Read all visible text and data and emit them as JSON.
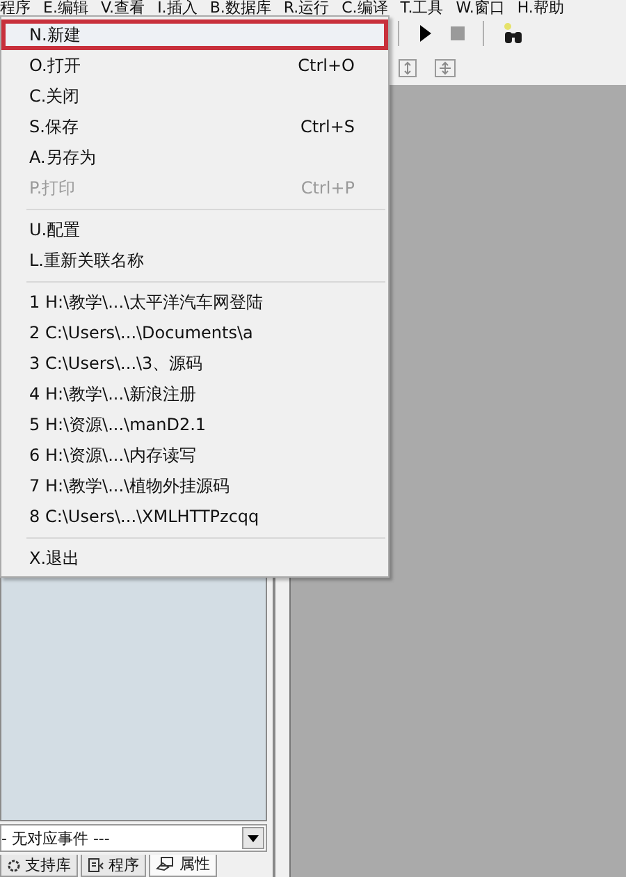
{
  "menubar": {
    "items": [
      {
        "label": "程序"
      },
      {
        "label": "E.编辑"
      },
      {
        "label": "V.查看"
      },
      {
        "label": "I.插入"
      },
      {
        "label": "B.数据库"
      },
      {
        "label": "R.运行"
      },
      {
        "label": "C.编译"
      },
      {
        "label": "T.工具"
      },
      {
        "label": "W.窗口"
      },
      {
        "label": "H.帮助"
      }
    ]
  },
  "file_menu": {
    "groups": [
      [
        {
          "label": "N.新建",
          "highlighted": true,
          "disabled": false
        },
        {
          "label": "O.打开",
          "shortcut": "Ctrl+O",
          "highlighted": false,
          "disabled": false
        },
        {
          "label": "C.关闭",
          "highlighted": false,
          "disabled": false
        },
        {
          "label": "S.保存",
          "shortcut": "Ctrl+S",
          "highlighted": false,
          "disabled": false
        },
        {
          "label": "A.另存为",
          "highlighted": false,
          "disabled": false
        },
        {
          "label": "P.打印",
          "shortcut": "Ctrl+P",
          "highlighted": false,
          "disabled": true
        }
      ],
      [
        {
          "label": "U.配置",
          "highlighted": false,
          "disabled": false
        },
        {
          "label": "L.重新关联名称",
          "highlighted": false,
          "disabled": false
        }
      ],
      [
        {
          "label": "1 H:\\教学\\...\\太平洋汽车网登陆",
          "highlighted": false,
          "disabled": false
        },
        {
          "label": "2 C:\\Users\\...\\Documents\\a",
          "highlighted": false,
          "disabled": false
        },
        {
          "label": "3 C:\\Users\\...\\3、源码",
          "highlighted": false,
          "disabled": false
        },
        {
          "label": "4 H:\\教学\\...\\新浪注册",
          "highlighted": false,
          "disabled": false
        },
        {
          "label": "5 H:\\资源\\...\\manD2.1",
          "highlighted": false,
          "disabled": false
        },
        {
          "label": "6 H:\\资源\\...\\内存读写",
          "highlighted": false,
          "disabled": false
        },
        {
          "label": "7 H:\\教学\\...\\植物外挂源码",
          "highlighted": false,
          "disabled": false
        },
        {
          "label": "8 C:\\Users\\...\\XMLHTTPzcqq",
          "highlighted": false,
          "disabled": false
        }
      ],
      [
        {
          "label": "X.退出",
          "highlighted": false,
          "disabled": false
        }
      ]
    ]
  },
  "event_dropdown": {
    "value": "- 无对应事件 ---"
  },
  "panel_tabs": [
    {
      "label": "支持库",
      "selected": false
    },
    {
      "label": "程序",
      "selected": false
    },
    {
      "label": "属性",
      "selected": true
    }
  ]
}
